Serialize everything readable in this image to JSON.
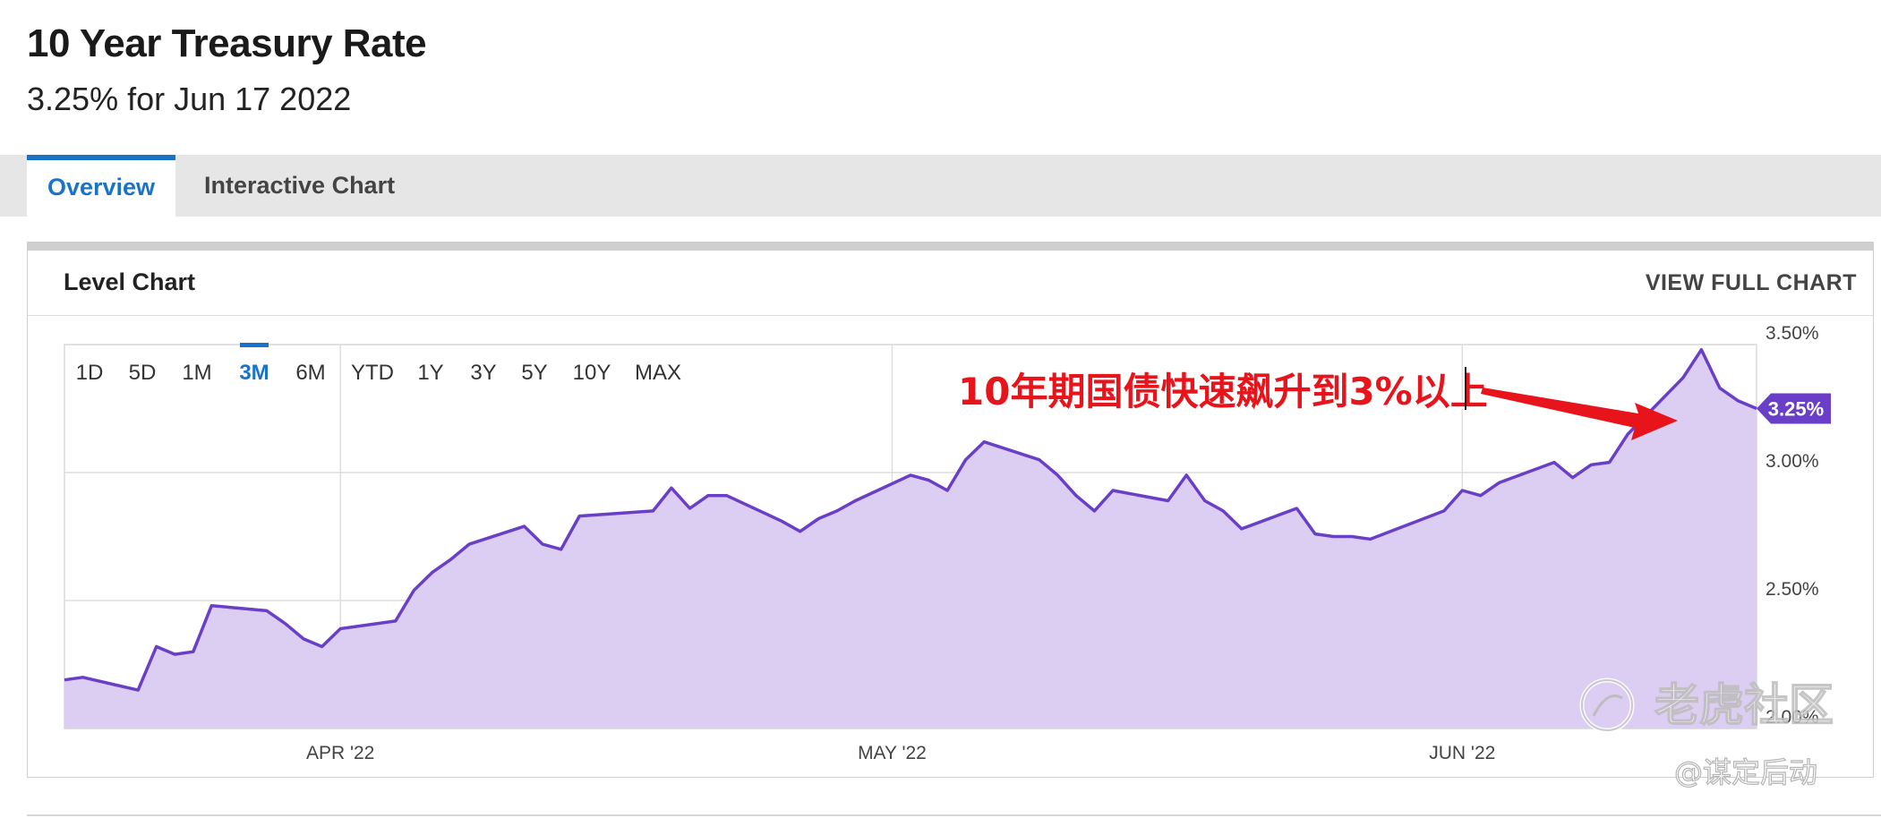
{
  "header": {
    "title": "10 Year Treasury Rate",
    "subtitle": "3.25% for Jun 17 2022"
  },
  "tabs": [
    {
      "label": "Overview",
      "active": true
    },
    {
      "label": "Interactive Chart",
      "active": false
    }
  ],
  "card": {
    "title": "Level Chart",
    "view_full": "VIEW FULL CHART"
  },
  "range_selector": {
    "options": [
      "1D",
      "5D",
      "1M",
      "3M",
      "6M",
      "YTD",
      "1Y",
      "3Y",
      "5Y",
      "10Y",
      "MAX"
    ],
    "selected": "3M"
  },
  "annotation": {
    "text": "10年期国债快速飙升到3%以上",
    "color": "#e8141b"
  },
  "watermark": {
    "brand": "老虎社区",
    "author": "@谋定后动"
  },
  "colors": {
    "accent": "#1a73c7",
    "line": "#6a3fc8",
    "fill": "#dccdf2",
    "badge": "#6a3fc8"
  },
  "chart_data": {
    "type": "area",
    "x_ticks": [
      "APR '22",
      "MAY '22",
      "JUN '22"
    ],
    "y_ticks": [
      "3.50%",
      "3.00%",
      "2.50%",
      "2.00%"
    ],
    "y_tick_values": [
      3.5,
      3.0,
      2.5,
      2.0
    ],
    "ylim": [
      2.0,
      3.5
    ],
    "current_value_label": "3.25%",
    "current_value": 3.25,
    "x": [
      "2022-03-17",
      "2022-03-18",
      "2022-03-21",
      "2022-03-22",
      "2022-03-23",
      "2022-03-24",
      "2022-03-25",
      "2022-03-28",
      "2022-03-29",
      "2022-03-30",
      "2022-03-31",
      "2022-04-01",
      "2022-04-04",
      "2022-04-05",
      "2022-04-06",
      "2022-04-07",
      "2022-04-08",
      "2022-04-11",
      "2022-04-12",
      "2022-04-13",
      "2022-04-14",
      "2022-04-18",
      "2022-04-19",
      "2022-04-20",
      "2022-04-21",
      "2022-04-22",
      "2022-04-25",
      "2022-04-26",
      "2022-04-27",
      "2022-04-28",
      "2022-04-29",
      "2022-05-02",
      "2022-05-03",
      "2022-05-04",
      "2022-05-05",
      "2022-05-06",
      "2022-05-09",
      "2022-05-10",
      "2022-05-11",
      "2022-05-12",
      "2022-05-13",
      "2022-05-16",
      "2022-05-17",
      "2022-05-18",
      "2022-05-19",
      "2022-05-20",
      "2022-05-23",
      "2022-05-24",
      "2022-05-25",
      "2022-05-26",
      "2022-05-27",
      "2022-05-31",
      "2022-06-01",
      "2022-06-02",
      "2022-06-03",
      "2022-06-06",
      "2022-06-07",
      "2022-06-08",
      "2022-06-09",
      "2022-06-10",
      "2022-06-13",
      "2022-06-14",
      "2022-06-15",
      "2022-06-16",
      "2022-06-17"
    ],
    "values": [
      2.19,
      2.2,
      2.15,
      2.32,
      2.29,
      2.3,
      2.48,
      2.46,
      2.41,
      2.35,
      2.32,
      2.39,
      2.42,
      2.54,
      2.61,
      2.66,
      2.72,
      2.79,
      2.72,
      2.7,
      2.83,
      2.85,
      2.94,
      2.86,
      2.91,
      2.91,
      2.81,
      2.77,
      2.82,
      2.85,
      2.89,
      2.99,
      2.97,
      2.93,
      3.05,
      3.12,
      3.05,
      2.99,
      2.91,
      2.85,
      2.93,
      2.89,
      2.99,
      2.89,
      2.85,
      2.78,
      2.86,
      2.76,
      2.75,
      2.75,
      2.74,
      2.85,
      2.93,
      2.91,
      2.96,
      3.04,
      2.98,
      3.03,
      3.04,
      3.15,
      3.37,
      3.48,
      3.33,
      3.28,
      3.25
    ]
  }
}
